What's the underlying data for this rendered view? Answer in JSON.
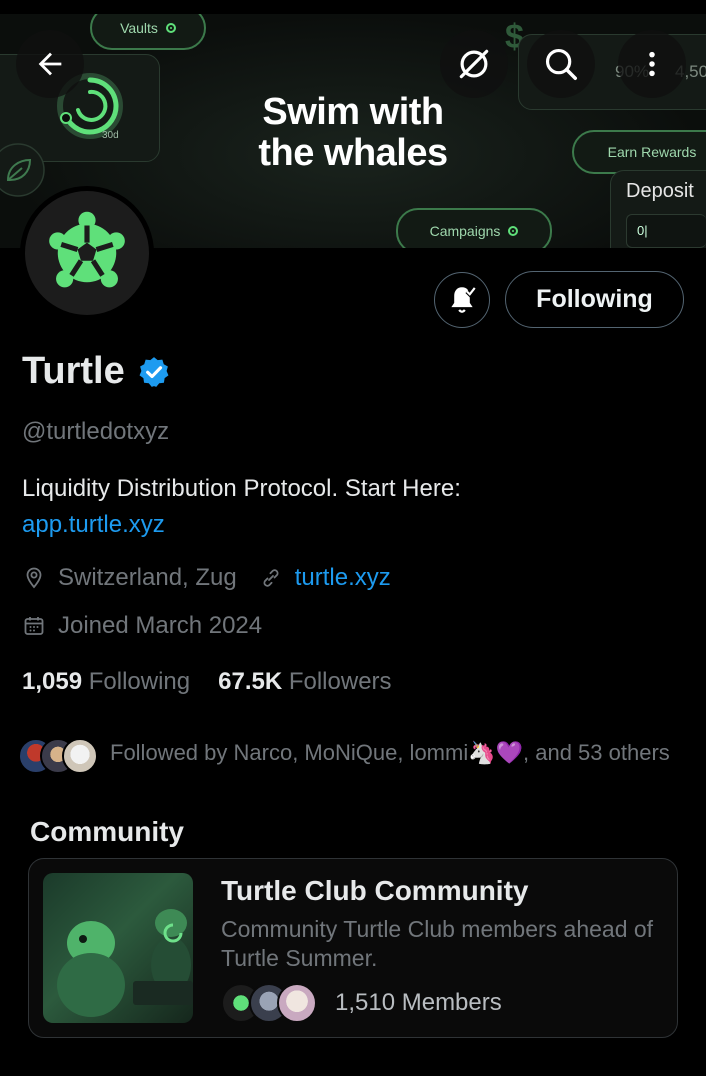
{
  "banner": {
    "headline_line1": "Swim with",
    "headline_line2": "the whales",
    "vaults_pill": "Vaults",
    "campaigns_pill": "Campaigns",
    "earn_pill": "Earn Rewards",
    "deposit_label": "Deposit",
    "deposit_value": "0|",
    "tag_30d": "30d",
    "stat_1": "90%",
    "stat_2": "4,50",
    "dollar_sign": "$"
  },
  "toolbar": {
    "back_icon": "arrow-left-icon",
    "grok_icon": "grok-icon",
    "search_icon": "search-icon",
    "more_icon": "more-vertical-icon"
  },
  "profile": {
    "name": "Turtle",
    "verified": true,
    "handle": "@turtledotxyz",
    "bio_text": "Liquidity Distribution Protocol.  Start Here:",
    "bio_link": "app.turtle.xyz",
    "location": "Switzerland, Zug",
    "website": "turtle.xyz",
    "joined": "Joined March 2024",
    "following_count": "1,059",
    "following_label": "Following",
    "followers_count": "67.5K",
    "followers_label": "Followers",
    "followed_by": "Followed by Narco, MoNiQue, lommi🦄💜, and 53 others"
  },
  "actions": {
    "notify_icon": "bell-check-icon",
    "follow_state": "Following"
  },
  "community": {
    "section_title": "Community",
    "name": "Turtle Club Community",
    "description": "Community Turtle Club members ahead of Turtle Summer.",
    "members": "1,510 Members"
  },
  "colors": {
    "accent_link": "#1d9bf0",
    "turtle_green": "#5fe07a",
    "muted_text": "#71767b",
    "verified_blue": "#1d9bf0"
  }
}
